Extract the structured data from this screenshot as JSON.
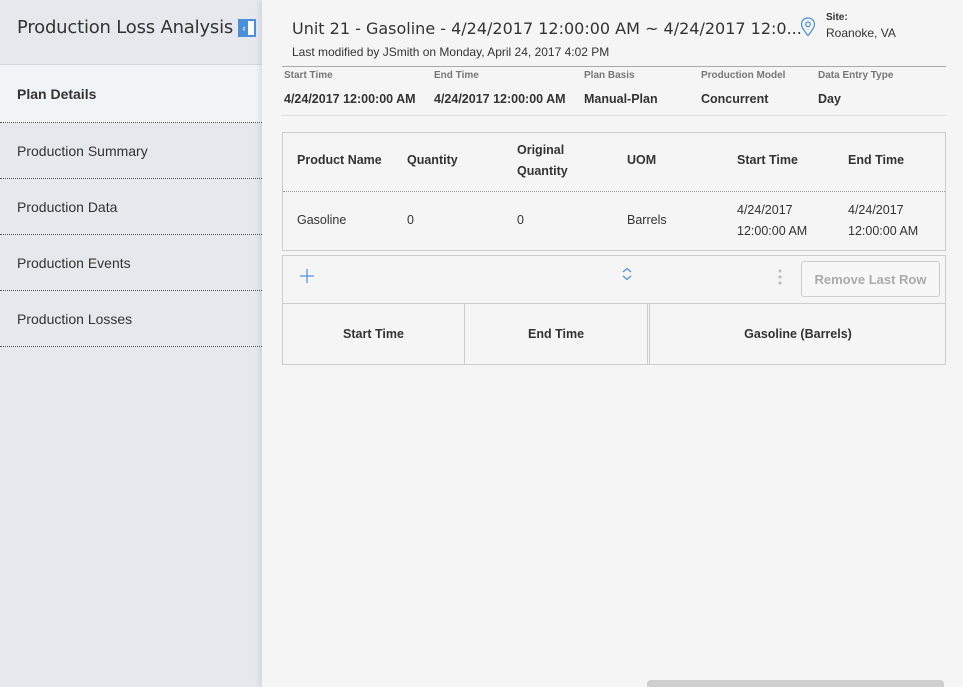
{
  "app": {
    "title": "Production Loss Analysis"
  },
  "sidebar": {
    "items": [
      {
        "label": "Plan Details"
      },
      {
        "label": "Production Summary"
      },
      {
        "label": "Production Data"
      },
      {
        "label": "Production Events"
      },
      {
        "label": "Production Losses"
      }
    ],
    "active_index": 0
  },
  "header": {
    "title": "Unit 21 - Gasoline - 4/24/2017 12:00:00 AM ~ 4/24/2017 12:0...",
    "subtitle": "Last modified by JSmith on Monday, April 24, 2017 4:02 PM",
    "site_label": "Site:",
    "site_value": "Roanoke, VA"
  },
  "meta": [
    {
      "label": "Start Time",
      "value": "4/24/2017 12:00:00 AM"
    },
    {
      "label": "End Time",
      "value": "4/24/2017 12:00:00 AM"
    },
    {
      "label": "Plan Basis",
      "value": "Manual-Plan"
    },
    {
      "label": "Production Model",
      "value": "Concurrent"
    },
    {
      "label": "Data Entry Type",
      "value": "Day"
    }
  ],
  "product_table": {
    "headers": {
      "product_name": "Product Name",
      "quantity": "Quantity",
      "original_quantity_l1": "Original",
      "original_quantity_l2": "Quantity",
      "uom": "UOM",
      "start_time": "Start Time",
      "end_time": "End Time"
    },
    "row": {
      "product_name": "Gasoline",
      "quantity": "0",
      "original_quantity": "0",
      "uom": "Barrels",
      "start_date": "4/24/2017",
      "start_time": "12:00:00 AM",
      "end_date": "4/24/2017",
      "end_time": "12:00:00 AM"
    }
  },
  "toolbar": {
    "remove_label": "Remove Last Row"
  },
  "grid": {
    "headers": [
      "Start Time",
      "End Time",
      "Gasoline (Barrels)"
    ]
  },
  "colors": {
    "accent": "#4a90d9",
    "sidebar_bg": "#e5e9ee",
    "main_bg": "#f5f5f5"
  }
}
